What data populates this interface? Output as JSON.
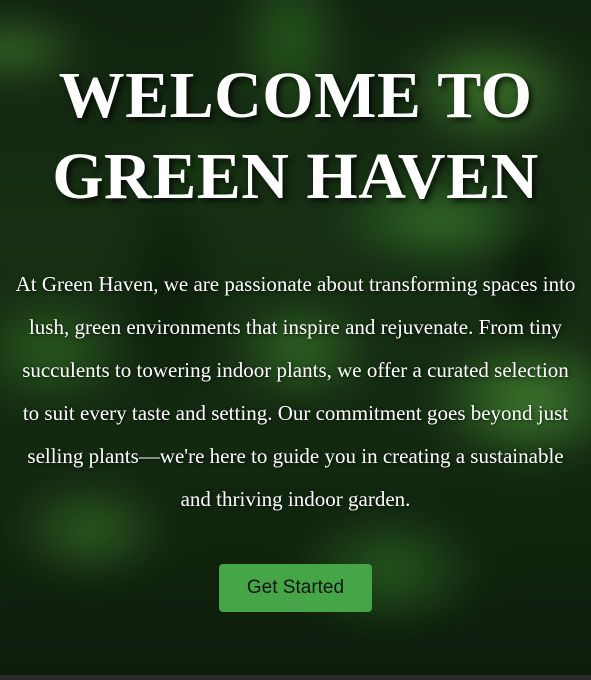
{
  "hero": {
    "title": "WELCOME TO GREEN HAVEN",
    "description": "At Green Haven, we are passionate about transforming spaces into lush, green environments that inspire and rejuvenate. From tiny succulents to towering indoor plants, we offer a curated selection to suit every taste and setting. Our commitment goes beyond just selling plants—we're here to guide you in creating a sustainable and thriving indoor garden.",
    "cta_label": "Get Started"
  },
  "colors": {
    "button_background": "#46a546",
    "button_text": "#111611",
    "text": "#ffffff"
  }
}
